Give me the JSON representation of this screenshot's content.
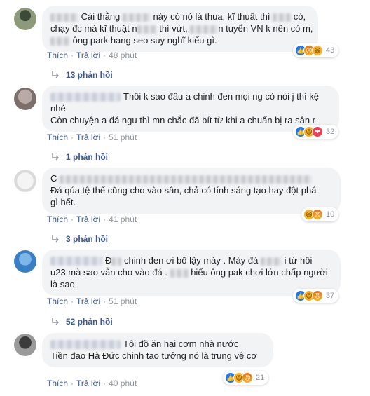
{
  "comments": [
    {
      "line1_a": "Cái thằng",
      "line1_b": "này có nó là thua, kĩ thuât thì",
      "line1_c": "có,",
      "line2_a": "chạy đc mà kĩ thuật n",
      "line2_b": "thì vứt,",
      "line2_c": "n tuyển VN k nên có m,",
      "line3": "ông park hang seo suy nghĩ kiểu gì.",
      "like": "Thích",
      "reply": "Trả lời",
      "time": "48 phút",
      "reaction_count": "43",
      "replies_label": "13 phản hồi"
    },
    {
      "line1_a": "Thôi k sao đâu a chinh đen mọi ng có nói j thì kệ",
      "line2": "nhé",
      "line3": "Còn chuyện a đá ngu thì mn chắc đã bít từ khi a chuẩn bị ra sân r",
      "like": "Thích",
      "reply": "Trả lời",
      "time": "51 phút",
      "reaction_count": "32",
      "replies_label": "1 phản hồi"
    },
    {
      "line1_a": "C",
      "line2": "Đá qúa tệ thế cũng cho vào sân, chả có tính sáng tạo hay đột phá",
      "line3": "gì hết.",
      "like": "Thích",
      "reply": "Trả lời",
      "time": "41 phút",
      "reaction_count": "10",
      "replies_label": "3 phản hồi"
    },
    {
      "line1_a": "Đ",
      "line1_b": "chinh đen ơi bố lậy mày . Mày đá",
      "line1_c": "i từ hồi",
      "line2_a": "u23 mà sao vẫn cho vào đá .",
      "line2_b": "hiểu ông pak chơi lớn chấp người",
      "line3": "là sao",
      "like": "Thích",
      "reply": "Trả lời",
      "time": "51 phút",
      "reaction_count": "37",
      "replies_label": "52 phản hồi"
    },
    {
      "line1_a": "Tội đồ ăn hại cơm nhà nước",
      "line2": "Tiền đạo Hà Đức chinh tao tưởng nó là trung vệ cơ",
      "like": "Thích",
      "reply": "Trả lời",
      "time": "40 phút",
      "reaction_count": "21"
    }
  ],
  "icons": {
    "like": "like-reaction-icon",
    "haha": "haha-reaction-icon",
    "angry": "angry-reaction-icon",
    "love": "love-reaction-icon",
    "reply_arrow": "reply-arrow-icon"
  },
  "colors": {
    "link": "#385898",
    "bubble": "#f2f3f5",
    "meta": "#90949c",
    "like": "#1877f2",
    "love": "#f33e58",
    "haha": "#f7b125"
  }
}
